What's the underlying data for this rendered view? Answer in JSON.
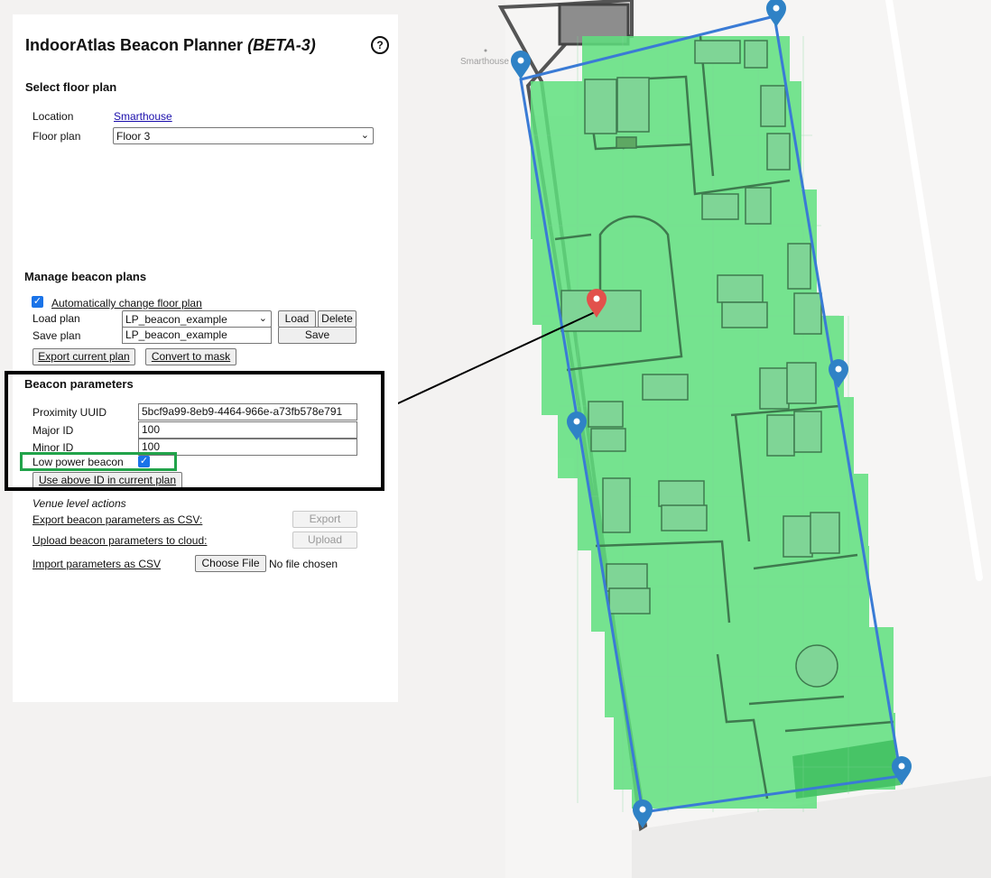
{
  "panel": {
    "title": "IndoorAtlas Beacon Planner",
    "title_suffix": "(BETA-3)",
    "help_icon": "help-circle-icon",
    "help_glyph": "?"
  },
  "floor_plan": {
    "heading": "Select floor plan",
    "location_label": "Location",
    "location_value": "Smarthouse",
    "floor_label": "Floor plan",
    "floor_value": "Floor 3"
  },
  "manage": {
    "heading": "Manage beacon plans",
    "auto_change_label": "Automatically change floor plan",
    "auto_change_checked": true,
    "load_label": "Load plan",
    "load_value": "LP_beacon_example",
    "load_button": "Load",
    "delete_button": "Delete",
    "save_label": "Save plan",
    "save_value": "LP_beacon_example",
    "save_button": "Save",
    "export_button": "Export current plan",
    "convert_button": "Convert to mask"
  },
  "beacon": {
    "heading": "Beacon parameters",
    "uuid_label": "Proximity UUID",
    "uuid_value": "5bcf9a99-8eb9-4464-966e-a73fb578e791",
    "major_label": "Major ID",
    "major_value": "100",
    "minor_label": "Minor ID",
    "minor_value": "100",
    "low_power_label": "Low power beacon",
    "low_power_checked": true,
    "use_id_button": "Use above ID in current plan"
  },
  "venue": {
    "heading": "Venue level actions",
    "export_csv_label": "Export beacon parameters as CSV:",
    "export_button": "Export",
    "upload_label": "Upload beacon parameters to cloud:",
    "upload_button": "Upload",
    "import_label": "Import parameters as CSV",
    "choose_file_button": "Choose File",
    "no_file_text": "No file chosen"
  },
  "map": {
    "place_label": "Smarthouse",
    "coverage_color": "#5fe07e",
    "outline_color": "#3a7bd5",
    "beacon_marker_color": "#2f82c6",
    "selected_marker_color": "#e2514c"
  },
  "colors": {
    "annotation_box": "#000000",
    "annotation_highlight": "#21a34a",
    "checkbox": "#1a73e8"
  }
}
